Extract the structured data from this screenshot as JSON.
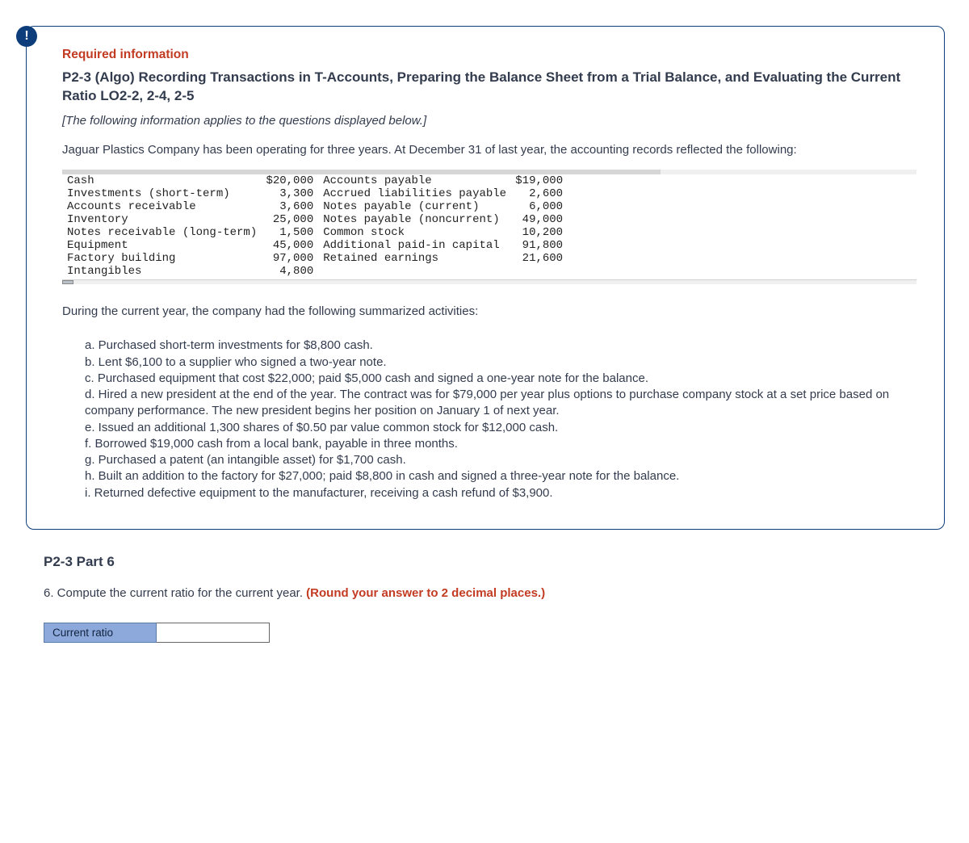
{
  "badge": "!",
  "header": {
    "required_label": "Required information",
    "title": "P2-3 (Algo) Recording Transactions in T-Accounts, Preparing the Balance Sheet from a Trial Balance, and Evaluating the Current Ratio LO2-2, 2-4, 2-5",
    "note": "[The following information applies to the questions displayed below.]",
    "intro": "Jaguar Plastics Company has been operating for three years. At December 31 of last year, the accounting records reflected the following:"
  },
  "ledger": {
    "left": [
      {
        "label": "Cash",
        "value": "$20,000"
      },
      {
        "label": "Investments (short-term)",
        "value": "3,300"
      },
      {
        "label": "Accounts receivable",
        "value": "3,600"
      },
      {
        "label": "Inventory",
        "value": "25,000"
      },
      {
        "label": "Notes receivable (long-term)",
        "value": "1,500"
      },
      {
        "label": "Equipment",
        "value": "45,000"
      },
      {
        "label": "Factory building",
        "value": "97,000"
      },
      {
        "label": "Intangibles",
        "value": "4,800"
      }
    ],
    "right": [
      {
        "label": "Accounts payable",
        "value": "$19,000"
      },
      {
        "label": "Accrued liabilities payable",
        "value": "2,600"
      },
      {
        "label": "Notes payable (current)",
        "value": "6,000"
      },
      {
        "label": "Notes payable (noncurrent)",
        "value": "49,000"
      },
      {
        "label": "Common stock",
        "value": "10,200"
      },
      {
        "label": "Additional paid-in capital",
        "value": "91,800"
      },
      {
        "label": "Retained earnings",
        "value": "21,600"
      }
    ]
  },
  "activities_intro": "During the current year, the company had the following summarized activities:",
  "activities": [
    "a. Purchased short-term investments for $8,800 cash.",
    "b. Lent $6,100 to a supplier who signed a two-year note.",
    "c. Purchased equipment that cost $22,000; paid $5,000 cash and signed a one-year note for the balance.",
    "d. Hired a new president at the end of the year. The contract was for $79,000 per year plus options to purchase company stock at a set price based on company performance. The new president begins her position on January 1 of next year.",
    "e. Issued an additional 1,300 shares of $0.50 par value common stock for $12,000 cash.",
    "f. Borrowed $19,000 cash from a local bank, payable in three months.",
    "g. Purchased a patent (an intangible asset) for $1,700 cash.",
    "h. Built an addition to the factory for $27,000; paid $8,800 in cash and signed a three-year note for the balance.",
    "i. Returned defective equipment to the manufacturer, receiving a cash refund of $3,900."
  ],
  "part": {
    "heading": "P2-3 Part 6",
    "question_prefix": "6. Compute the current ratio for the current year. ",
    "question_hint": "(Round your answer to 2 decimal places.)"
  },
  "answer": {
    "label": "Current ratio",
    "value": ""
  }
}
